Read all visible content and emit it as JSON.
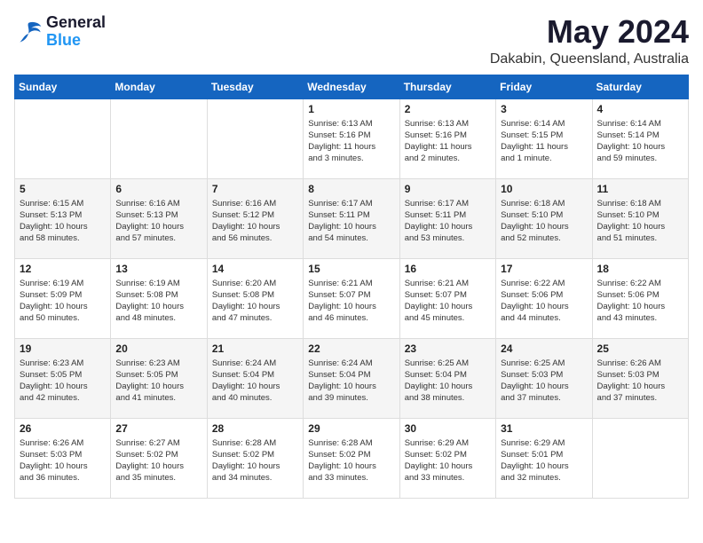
{
  "header": {
    "logo_line1": "General",
    "logo_line2": "Blue",
    "month": "May 2024",
    "location": "Dakabin, Queensland, Australia"
  },
  "weekdays": [
    "Sunday",
    "Monday",
    "Tuesday",
    "Wednesday",
    "Thursday",
    "Friday",
    "Saturday"
  ],
  "weeks": [
    [
      {
        "day": "",
        "info": ""
      },
      {
        "day": "",
        "info": ""
      },
      {
        "day": "",
        "info": ""
      },
      {
        "day": "1",
        "info": "Sunrise: 6:13 AM\nSunset: 5:16 PM\nDaylight: 11 hours\nand 3 minutes."
      },
      {
        "day": "2",
        "info": "Sunrise: 6:13 AM\nSunset: 5:16 PM\nDaylight: 11 hours\nand 2 minutes."
      },
      {
        "day": "3",
        "info": "Sunrise: 6:14 AM\nSunset: 5:15 PM\nDaylight: 11 hours\nand 1 minute."
      },
      {
        "day": "4",
        "info": "Sunrise: 6:14 AM\nSunset: 5:14 PM\nDaylight: 10 hours\nand 59 minutes."
      }
    ],
    [
      {
        "day": "5",
        "info": "Sunrise: 6:15 AM\nSunset: 5:13 PM\nDaylight: 10 hours\nand 58 minutes."
      },
      {
        "day": "6",
        "info": "Sunrise: 6:16 AM\nSunset: 5:13 PM\nDaylight: 10 hours\nand 57 minutes."
      },
      {
        "day": "7",
        "info": "Sunrise: 6:16 AM\nSunset: 5:12 PM\nDaylight: 10 hours\nand 56 minutes."
      },
      {
        "day": "8",
        "info": "Sunrise: 6:17 AM\nSunset: 5:11 PM\nDaylight: 10 hours\nand 54 minutes."
      },
      {
        "day": "9",
        "info": "Sunrise: 6:17 AM\nSunset: 5:11 PM\nDaylight: 10 hours\nand 53 minutes."
      },
      {
        "day": "10",
        "info": "Sunrise: 6:18 AM\nSunset: 5:10 PM\nDaylight: 10 hours\nand 52 minutes."
      },
      {
        "day": "11",
        "info": "Sunrise: 6:18 AM\nSunset: 5:10 PM\nDaylight: 10 hours\nand 51 minutes."
      }
    ],
    [
      {
        "day": "12",
        "info": "Sunrise: 6:19 AM\nSunset: 5:09 PM\nDaylight: 10 hours\nand 50 minutes."
      },
      {
        "day": "13",
        "info": "Sunrise: 6:19 AM\nSunset: 5:08 PM\nDaylight: 10 hours\nand 48 minutes."
      },
      {
        "day": "14",
        "info": "Sunrise: 6:20 AM\nSunset: 5:08 PM\nDaylight: 10 hours\nand 47 minutes."
      },
      {
        "day": "15",
        "info": "Sunrise: 6:21 AM\nSunset: 5:07 PM\nDaylight: 10 hours\nand 46 minutes."
      },
      {
        "day": "16",
        "info": "Sunrise: 6:21 AM\nSunset: 5:07 PM\nDaylight: 10 hours\nand 45 minutes."
      },
      {
        "day": "17",
        "info": "Sunrise: 6:22 AM\nSunset: 5:06 PM\nDaylight: 10 hours\nand 44 minutes."
      },
      {
        "day": "18",
        "info": "Sunrise: 6:22 AM\nSunset: 5:06 PM\nDaylight: 10 hours\nand 43 minutes."
      }
    ],
    [
      {
        "day": "19",
        "info": "Sunrise: 6:23 AM\nSunset: 5:05 PM\nDaylight: 10 hours\nand 42 minutes."
      },
      {
        "day": "20",
        "info": "Sunrise: 6:23 AM\nSunset: 5:05 PM\nDaylight: 10 hours\nand 41 minutes."
      },
      {
        "day": "21",
        "info": "Sunrise: 6:24 AM\nSunset: 5:04 PM\nDaylight: 10 hours\nand 40 minutes."
      },
      {
        "day": "22",
        "info": "Sunrise: 6:24 AM\nSunset: 5:04 PM\nDaylight: 10 hours\nand 39 minutes."
      },
      {
        "day": "23",
        "info": "Sunrise: 6:25 AM\nSunset: 5:04 PM\nDaylight: 10 hours\nand 38 minutes."
      },
      {
        "day": "24",
        "info": "Sunrise: 6:25 AM\nSunset: 5:03 PM\nDaylight: 10 hours\nand 37 minutes."
      },
      {
        "day": "25",
        "info": "Sunrise: 6:26 AM\nSunset: 5:03 PM\nDaylight: 10 hours\nand 37 minutes."
      }
    ],
    [
      {
        "day": "26",
        "info": "Sunrise: 6:26 AM\nSunset: 5:03 PM\nDaylight: 10 hours\nand 36 minutes."
      },
      {
        "day": "27",
        "info": "Sunrise: 6:27 AM\nSunset: 5:02 PM\nDaylight: 10 hours\nand 35 minutes."
      },
      {
        "day": "28",
        "info": "Sunrise: 6:28 AM\nSunset: 5:02 PM\nDaylight: 10 hours\nand 34 minutes."
      },
      {
        "day": "29",
        "info": "Sunrise: 6:28 AM\nSunset: 5:02 PM\nDaylight: 10 hours\nand 33 minutes."
      },
      {
        "day": "30",
        "info": "Sunrise: 6:29 AM\nSunset: 5:02 PM\nDaylight: 10 hours\nand 33 minutes."
      },
      {
        "day": "31",
        "info": "Sunrise: 6:29 AM\nSunset: 5:01 PM\nDaylight: 10 hours\nand 32 minutes."
      },
      {
        "day": "",
        "info": ""
      }
    ]
  ]
}
